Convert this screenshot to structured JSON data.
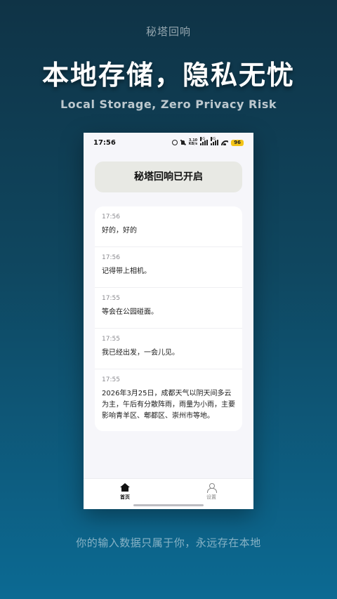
{
  "brand": "秘塔回响",
  "headline": "本地存储，隐私无忧",
  "subhead": "Local Storage, Zero Privacy Risk",
  "phone": {
    "status_bar": {
      "time": "17:56",
      "speed_value": "3.10",
      "speed_unit": "KB/s",
      "network_1": "5G",
      "network_2": "5G",
      "battery": "96"
    },
    "banner": "秘塔回响已开启",
    "messages": [
      {
        "time": "17:56",
        "text": "好的，好的"
      },
      {
        "time": "17:56",
        "text": "记得带上相机。"
      },
      {
        "time": "17:55",
        "text": "等会在公园碰面。"
      },
      {
        "time": "17:55",
        "text": "我已经出发，一会儿见。"
      },
      {
        "time": "17:55",
        "text": "2026年3月25日，成都天气以阴天间多云为主，午后有分散阵雨，雨量为小雨，主要影响青羊区、郫都区、崇州市等地。"
      }
    ],
    "tabs": [
      {
        "label": "首页",
        "icon": "home-icon"
      },
      {
        "label": "设置",
        "icon": "user-icon"
      }
    ]
  },
  "tagline": "你的输入数据只属于你，永远存在本地",
  "colors": {
    "background_top": "#0f3346",
    "background_bottom": "#0c6a93",
    "banner_bg": "#e8e9e4",
    "battery": "#f3c417"
  }
}
